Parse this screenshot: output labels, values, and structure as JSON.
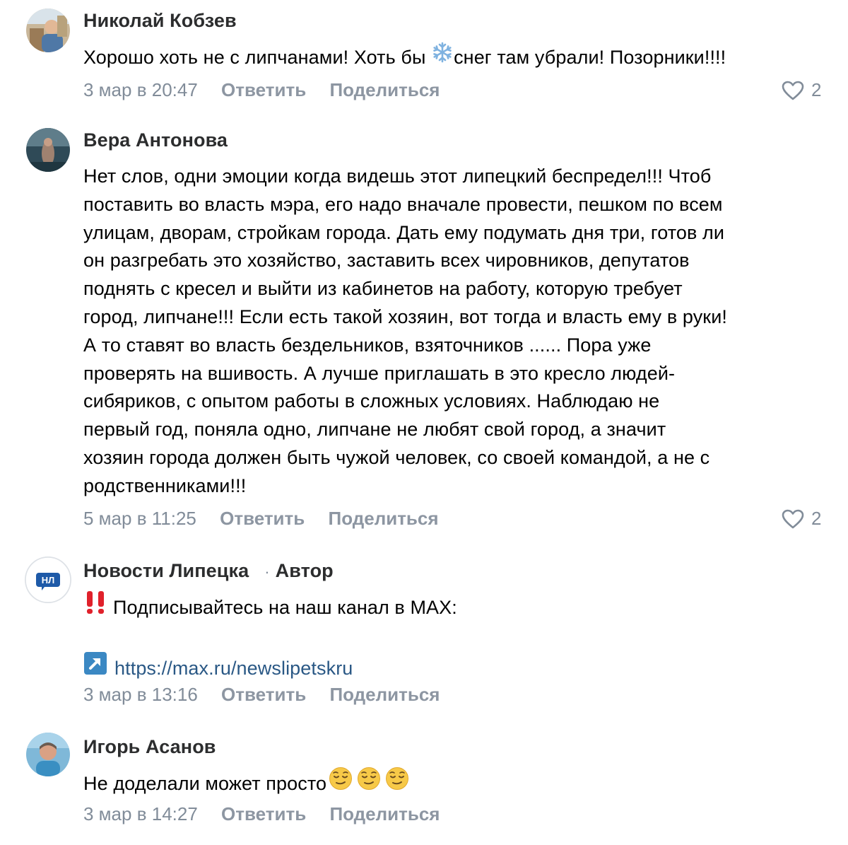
{
  "comments": [
    {
      "author": "Николай Кобзев",
      "lines": [
        "Хорошо хоть не с липчанами! Хоть бы",
        "снег там убрали! Позорники!!!!"
      ],
      "date": "3 мар в 20:47",
      "reply": "Ответить",
      "share": "Поделиться",
      "likes": "2"
    },
    {
      "author": "Вера Антонова",
      "lines": [
        "Нет слов, одни эмоции когда видешь этот липецкий беспредел!!! Чтоб",
        "поставить во власть мэра, его надо вначале провести, пешком по всем",
        "улицам, дворам, стройкам города. Дать ему подумать дня три, готов ли",
        "он разгребать это хозяйство, заставить всех чировников, депутатов",
        "поднять с кресел и выйти из кабинетов на работу, которую требует",
        "город, липчане!!! Если есть такой хозяин, вот тогда и власть ему в руки!",
        "А то ставят во власть бездельников, взяточников ...... Пора уже",
        "проверять на вшивость. А лучше приглашать в это кресло людей-",
        "сибяриков, с опытом работы в сложных условиях. Наблюдаю не",
        "первый год, поняла одно, липчане не любят свой город, а значит",
        "хозяин города должен быть чужой человек, со своей командой, а не с",
        "родственниками!!!"
      ],
      "date": "5 мар в 11:25",
      "reply": "Ответить",
      "share": "Поделиться",
      "likes": "2"
    },
    {
      "author": "Новости Липецка",
      "author_dot": "·",
      "author_tag": "Автор",
      "avatar_text": "НЛ",
      "line1": "Подписывайтесь на наш канал в MAX:",
      "link": "https://max.ru/newslipetskru",
      "date": "3 мар в 13:16",
      "reply": "Ответить",
      "share": "Поделиться"
    },
    {
      "author": "Игорь Асанов",
      "line1": "Не доделали может просто",
      "date": "3 мар в 14:27",
      "reply": "Ответить",
      "share": "Поделиться"
    }
  ],
  "icons": {
    "like": "heart-outline-icon",
    "snowflake": "snowflake-emoji",
    "exclamation": "double-exclamation-emoji",
    "link_arrow": "up-right-arrow-emoji",
    "face": "relieved-face-emoji"
  },
  "colors": {
    "meta": "#818c99",
    "author": "#2c2d2e",
    "text": "#000000",
    "avatar_brand": "#1e5aa8",
    "exclamation": "#e0212b",
    "arrow_box": "#3b88c3"
  }
}
